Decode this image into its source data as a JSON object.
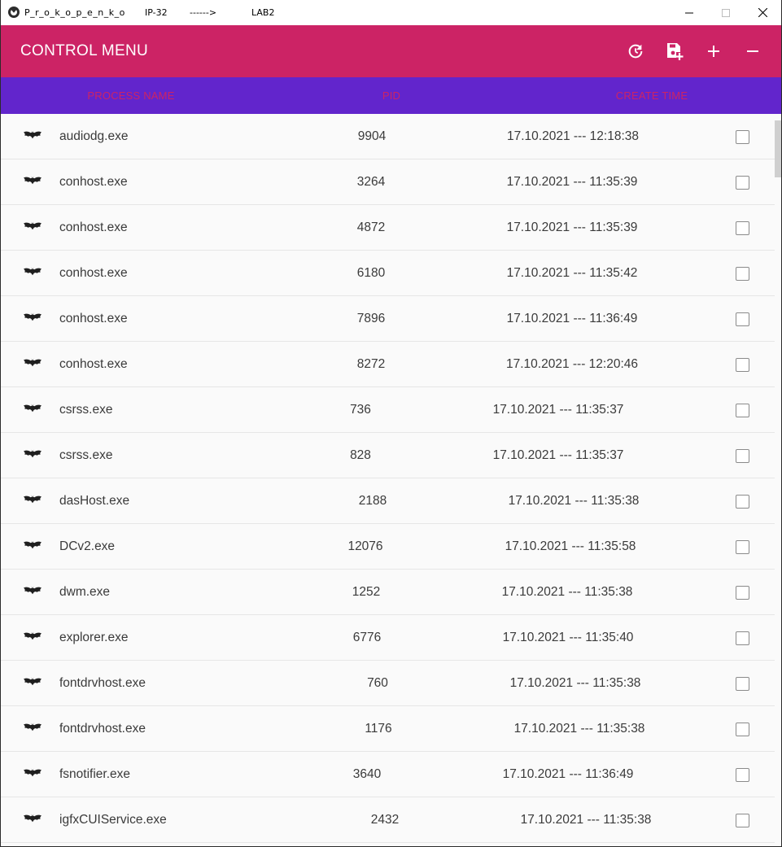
{
  "window": {
    "title_name": "P_r_o_k_o_p_e_n_k_o",
    "title_group": "IP-32",
    "title_arrow": "------>",
    "title_lab": "LAB2"
  },
  "appbar": {
    "title": "CONTROL MENU",
    "actions": [
      "refresh-icon",
      "save-add-icon",
      "plus-icon",
      "minus-icon"
    ]
  },
  "table": {
    "headers": {
      "name": "PROCESS NAME",
      "pid": "PID",
      "time": "CREATE TIME"
    },
    "rows": [
      {
        "name": "audiodg.exe",
        "pid": "9904",
        "time": "17.10.2021 --- 12:18:38"
      },
      {
        "name": "conhost.exe",
        "pid": "3264",
        "time": "17.10.2021 --- 11:35:39"
      },
      {
        "name": "conhost.exe",
        "pid": "4872",
        "time": "17.10.2021 --- 11:35:39"
      },
      {
        "name": "conhost.exe",
        "pid": "6180",
        "time": "17.10.2021 --- 11:35:42"
      },
      {
        "name": "conhost.exe",
        "pid": "7896",
        "time": "17.10.2021 --- 11:36:49"
      },
      {
        "name": "conhost.exe",
        "pid": "8272",
        "time": "17.10.2021 --- 12:20:46"
      },
      {
        "name": "csrss.exe",
        "pid": "736",
        "time": "17.10.2021 --- 11:35:37"
      },
      {
        "name": "csrss.exe",
        "pid": "828",
        "time": "17.10.2021 --- 11:35:37"
      },
      {
        "name": "dasHost.exe",
        "pid": "2188",
        "time": "17.10.2021 --- 11:35:38"
      },
      {
        "name": "DCv2.exe",
        "pid": "12076",
        "time": "17.10.2021 --- 11:35:58"
      },
      {
        "name": "dwm.exe",
        "pid": "1252",
        "time": "17.10.2021 --- 11:35:38"
      },
      {
        "name": "explorer.exe",
        "pid": "6776",
        "time": "17.10.2021 --- 11:35:40"
      },
      {
        "name": "fontdrvhost.exe",
        "pid": "760",
        "time": "17.10.2021 --- 11:35:38"
      },
      {
        "name": "fontdrvhost.exe",
        "pid": "1176",
        "time": "17.10.2021 --- 11:35:38"
      },
      {
        "name": "fsnotifier.exe",
        "pid": "3640",
        "time": "17.10.2021 --- 11:36:49"
      },
      {
        "name": "igfxCUIService.exe",
        "pid": "2432",
        "time": "17.10.2021 --- 11:35:38"
      }
    ]
  },
  "colors": {
    "appbar": "#cc2365",
    "header": "#6225cc",
    "header_text": "#cc2365"
  }
}
